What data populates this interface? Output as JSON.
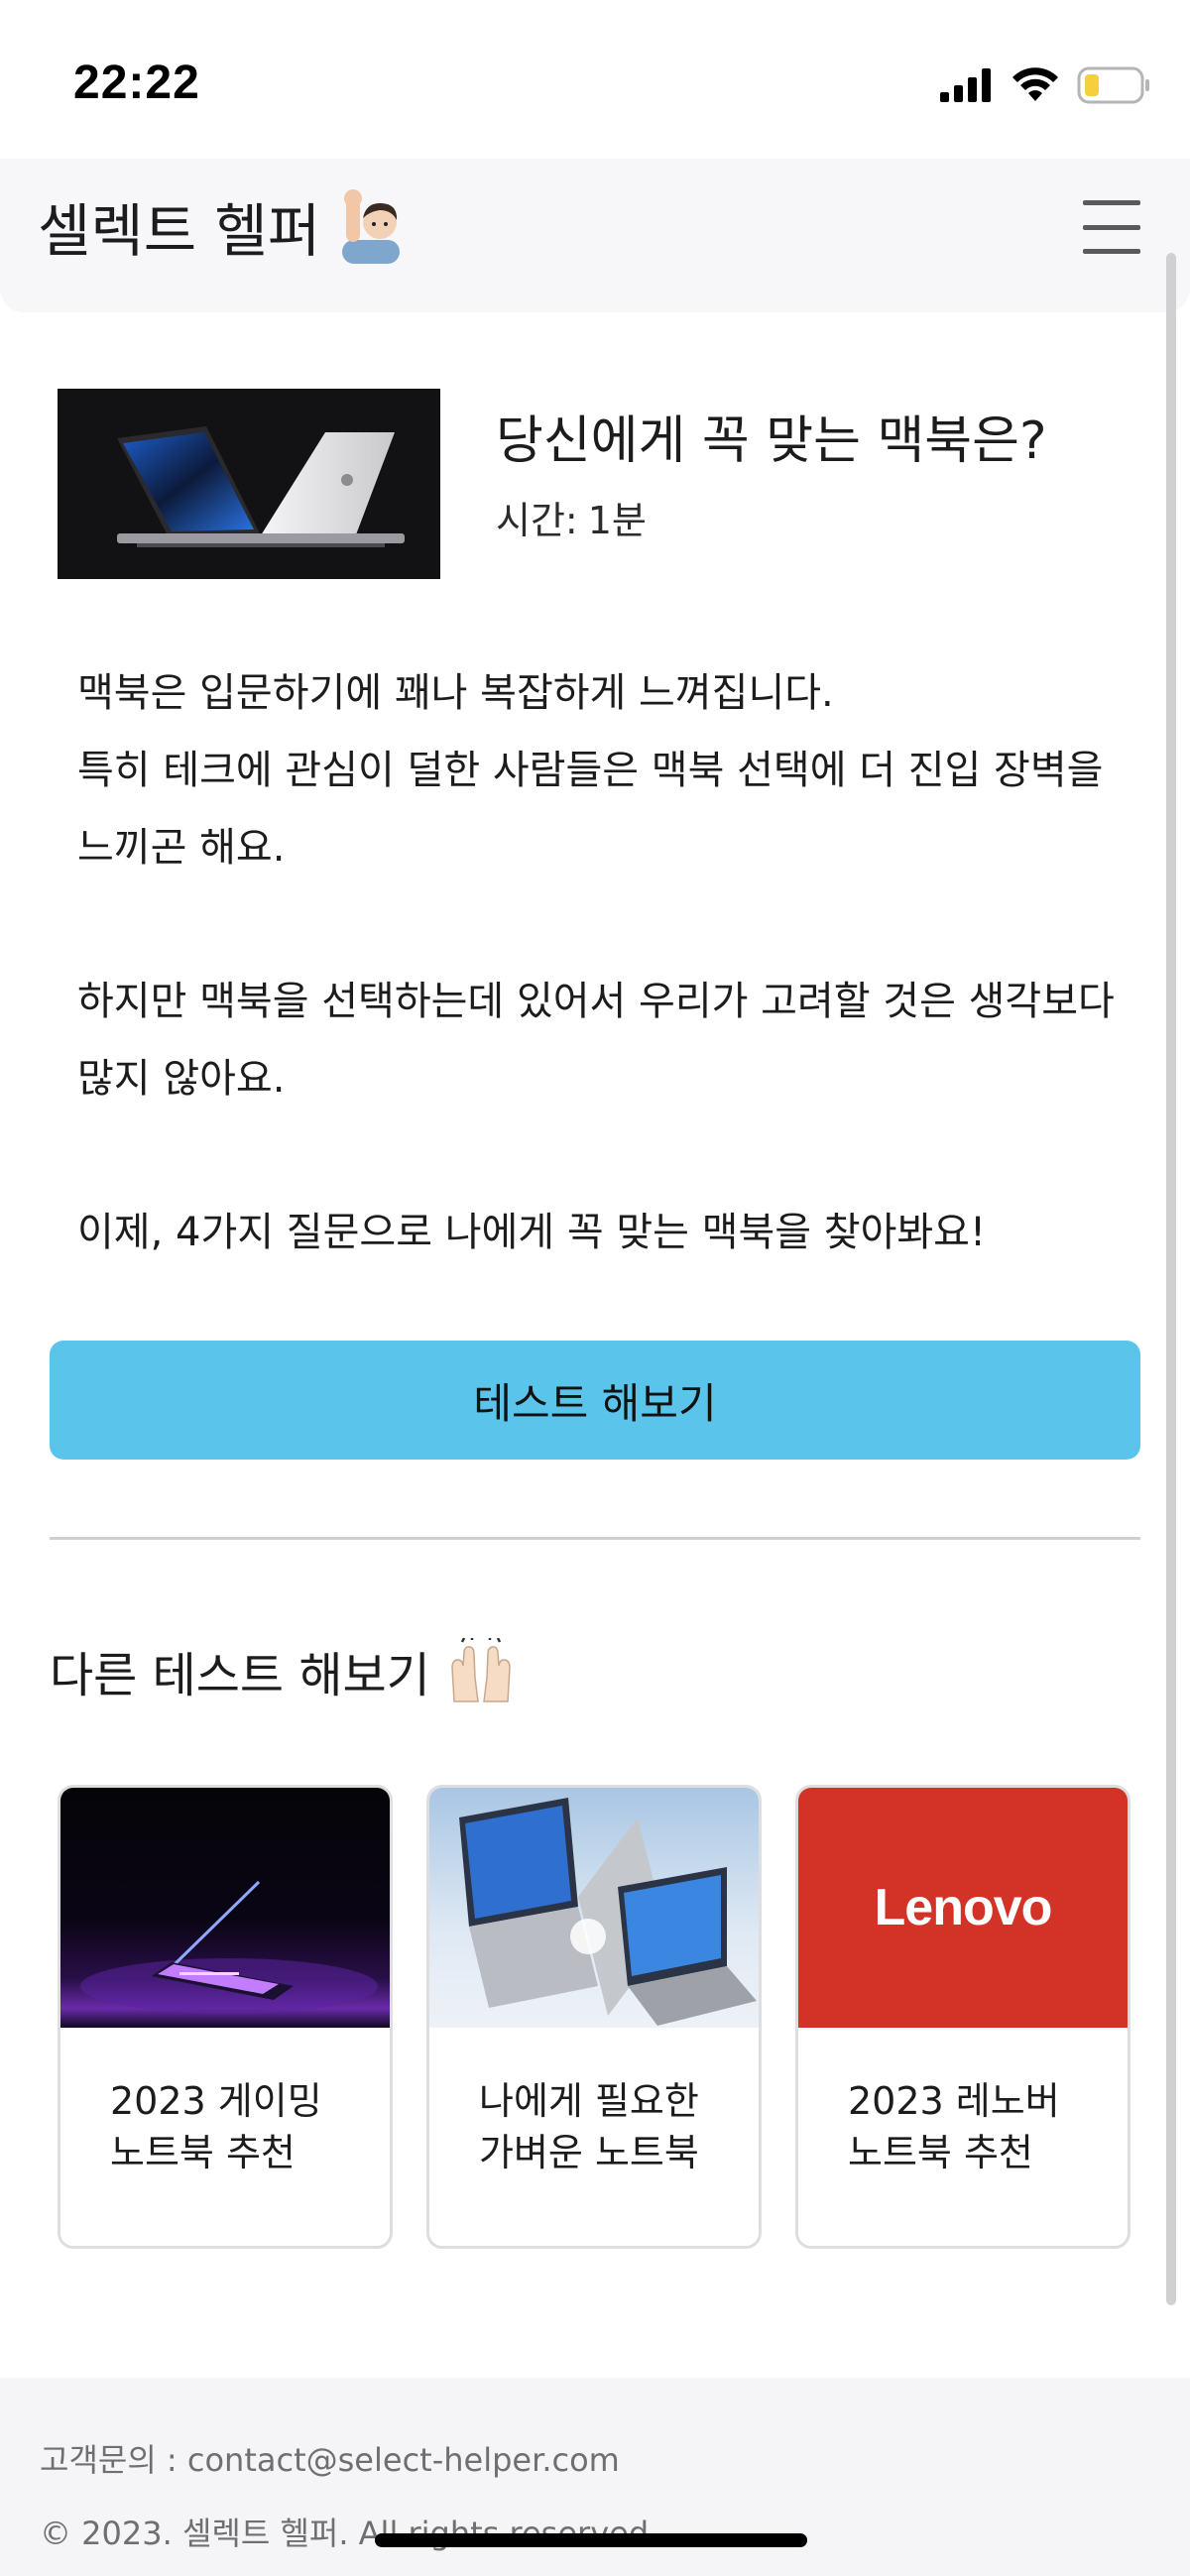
{
  "status_bar": {
    "time": "22:22",
    "icons": [
      "signal-icon",
      "wifi-icon",
      "battery-icon"
    ],
    "battery_color": "#f5cf3e"
  },
  "header": {
    "title": "셀렉트 헬퍼",
    "emoji": "person-raising-hand-icon",
    "menu_icon": "hamburger-menu-icon"
  },
  "hero": {
    "title": "당신에게 꼭 맞는 맥북은?",
    "time_label": "시간:",
    "time_value": "1분",
    "image": "macbook-pro-image"
  },
  "description": {
    "paragraph1_line1": "맥북은 입문하기에 꽤나 복잡하게 느껴집니다.",
    "paragraph1_line2": "특히 테크에 관심이 덜한 사람들은 맥북 선택에 더 진입 장벽을 느끼곤 해요.",
    "paragraph2": "하지만 맥북을 선택하는데 있어서 우리가 고려할 것은 생각보다 많지 않아요.",
    "paragraph3": "이제, 4가지 질문으로 나에게 꼭 맞는 맥북을 찾아봐요!"
  },
  "cta": {
    "label": "테스트 해보기",
    "color": "#5bc4eb"
  },
  "other_tests": {
    "title": "다른 테스트 해보기",
    "emoji": "raising-hands-icon",
    "cards": [
      {
        "label": "2023 게이밍\n노트북 추천",
        "image": "gaming-laptop-image"
      },
      {
        "label": "나에게 필요한\n가벼운 노트북",
        "image": "light-laptops-image"
      },
      {
        "label": "2023 레노버\n노트북 추천",
        "image": "lenovo-logo-image",
        "logo_text": "Lenovo",
        "brand_color": "#d33226"
      }
    ]
  },
  "footer": {
    "contact": "고객문의 : contact@select-helper.com",
    "copyright": "© 2023. 셀렉트 헬퍼. All rights reserved."
  }
}
